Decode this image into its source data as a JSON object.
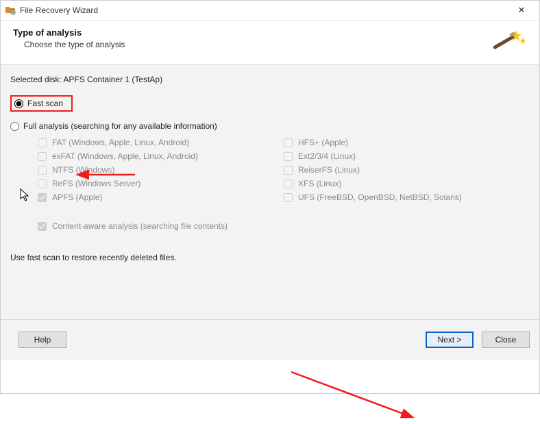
{
  "titlebar": {
    "app_title": "File Recovery Wizard",
    "close_glyph": "✕"
  },
  "header": {
    "title": "Type of analysis",
    "subtitle": "Choose the type of analysis"
  },
  "selected_disk_label": "Selected disk: APFS Container 1 (TestAp)",
  "options": {
    "fast_scan": "Fast scan",
    "full_analysis": "Full analysis (searching for any available information)"
  },
  "filesystems_left": [
    {
      "label": "FAT (Windows, Apple, Linux, Android)",
      "checked": false
    },
    {
      "label": "exFAT (Windows, Apple, Linux, Android)",
      "checked": false
    },
    {
      "label": "NTFS (Windows)",
      "checked": false
    },
    {
      "label": "ReFS (Windows Server)",
      "checked": false
    },
    {
      "label": "APFS (Apple)",
      "checked": true
    }
  ],
  "filesystems_right": [
    {
      "label": "HFS+ (Apple)",
      "checked": false
    },
    {
      "label": "Ext2/3/4 (Linux)",
      "checked": false
    },
    {
      "label": "ReiserFS (Linux)",
      "checked": false
    },
    {
      "label": "XFS (Linux)",
      "checked": false
    },
    {
      "label": "UFS (FreeBSD, OpenBSD, NetBSD, Solaris)",
      "checked": false
    }
  ],
  "content_aware": {
    "label": "Content-aware analysis (searching file contents)",
    "checked": true
  },
  "hint": "Use fast scan to restore recently deleted files.",
  "buttons": {
    "help": "Help",
    "next": "Next >",
    "close": "Close"
  }
}
